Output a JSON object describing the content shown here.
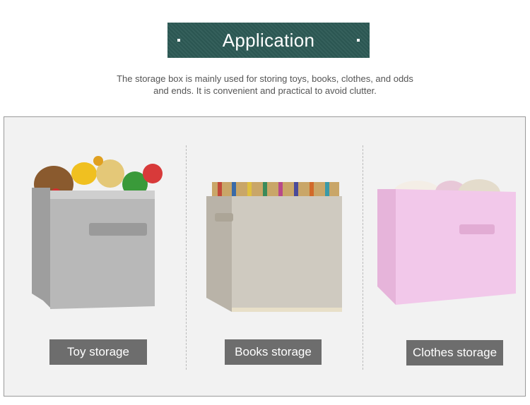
{
  "header": {
    "title": "Application"
  },
  "intro": {
    "line1": "The storage box is mainly used for storing toys, books, clothes, and odds",
    "line2": "and ends. It is convenient and practical to avoid clutter."
  },
  "items": [
    {
      "label": "Toy storage",
      "color": "#b8b8b8"
    },
    {
      "label": "Books storage",
      "color": "#cfcac0"
    },
    {
      "label": "Clothes storage",
      "color": "#f2c8ea"
    }
  ],
  "colors": {
    "banner": "#2d5a55",
    "label_bg": "#6d6d6d",
    "panel_bg": "#f2f2f2"
  }
}
